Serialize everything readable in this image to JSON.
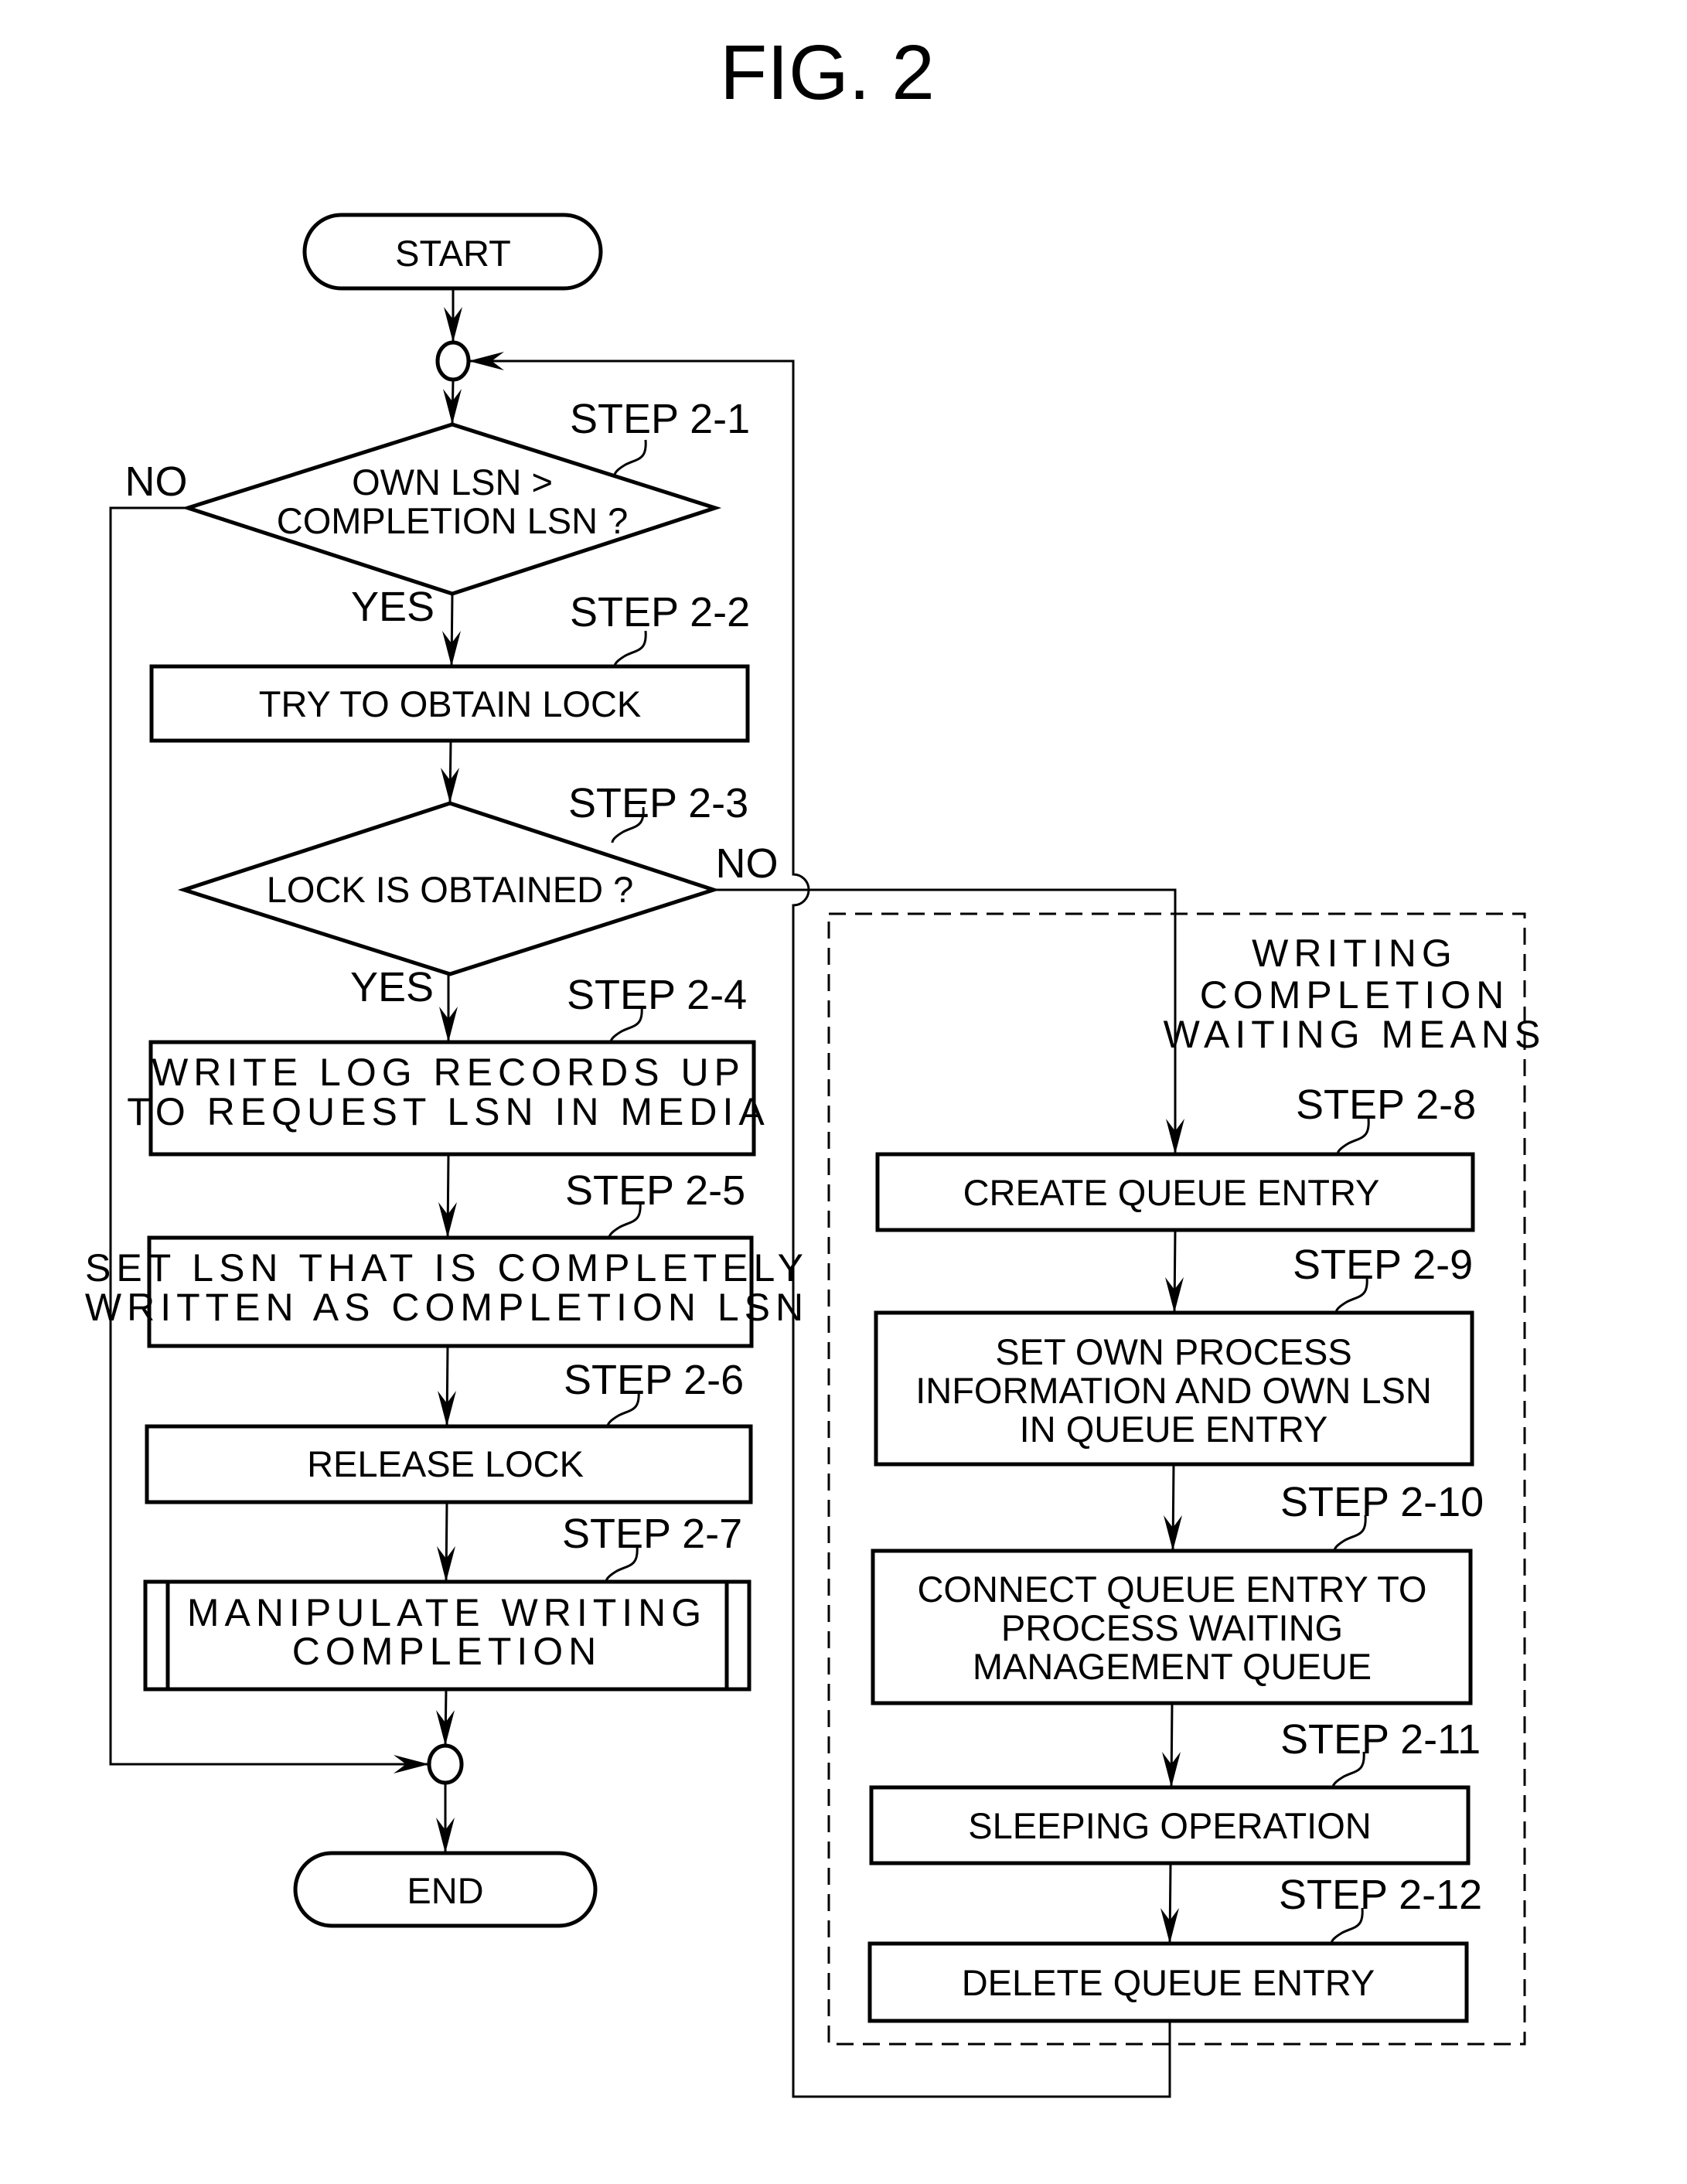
{
  "figure": {
    "title": "FIG. 2",
    "start_label": "START",
    "end_label": "END",
    "branch_labels": {
      "step_2_1_no": "NO",
      "step_2_1_yes": "YES",
      "step_2_3_no": "NO",
      "step_2_3_yes": "YES"
    },
    "group": {
      "label_lines": [
        "WRITING",
        "COMPLETION",
        "WAITING MEANS"
      ]
    },
    "steps": [
      {
        "id": "2-1",
        "label": "STEP 2-1",
        "type": "decision",
        "lines": [
          "OWN LSN >",
          "COMPLETION LSN ?"
        ]
      },
      {
        "id": "2-2",
        "label": "STEP 2-2",
        "type": "process",
        "lines": [
          "TRY TO OBTAIN LOCK"
        ]
      },
      {
        "id": "2-3",
        "label": "STEP 2-3",
        "type": "decision",
        "lines": [
          "LOCK IS OBTAINED ?"
        ]
      },
      {
        "id": "2-4",
        "label": "STEP 2-4",
        "type": "process",
        "lines": [
          "WRITE LOG RECORDS UP",
          "TO REQUEST LSN IN MEDIA"
        ]
      },
      {
        "id": "2-5",
        "label": "STEP 2-5",
        "type": "process",
        "lines": [
          "SET LSN THAT IS COMPLETELY",
          "WRITTEN AS COMPLETION LSN"
        ]
      },
      {
        "id": "2-6",
        "label": "STEP 2-6",
        "type": "process",
        "lines": [
          "RELEASE LOCK"
        ]
      },
      {
        "id": "2-7",
        "label": "STEP 2-7",
        "type": "subroutine",
        "lines": [
          "MANIPULATE WRITING",
          "COMPLETION"
        ]
      },
      {
        "id": "2-8",
        "label": "STEP 2-8",
        "type": "process",
        "lines": [
          "CREATE QUEUE ENTRY"
        ]
      },
      {
        "id": "2-9",
        "label": "STEP 2-9",
        "type": "process",
        "lines": [
          "SET OWN PROCESS",
          "INFORMATION AND OWN LSN",
          "IN QUEUE ENTRY"
        ]
      },
      {
        "id": "2-10",
        "label": "STEP 2-10",
        "type": "process",
        "lines": [
          "CONNECT QUEUE ENTRY TO",
          "PROCESS WAITING",
          "MANAGEMENT QUEUE"
        ]
      },
      {
        "id": "2-11",
        "label": "STEP 2-11",
        "type": "process",
        "lines": [
          "SLEEPING OPERATION"
        ]
      },
      {
        "id": "2-12",
        "label": "STEP 2-12",
        "type": "process",
        "lines": [
          "DELETE QUEUE ENTRY"
        ]
      }
    ]
  }
}
